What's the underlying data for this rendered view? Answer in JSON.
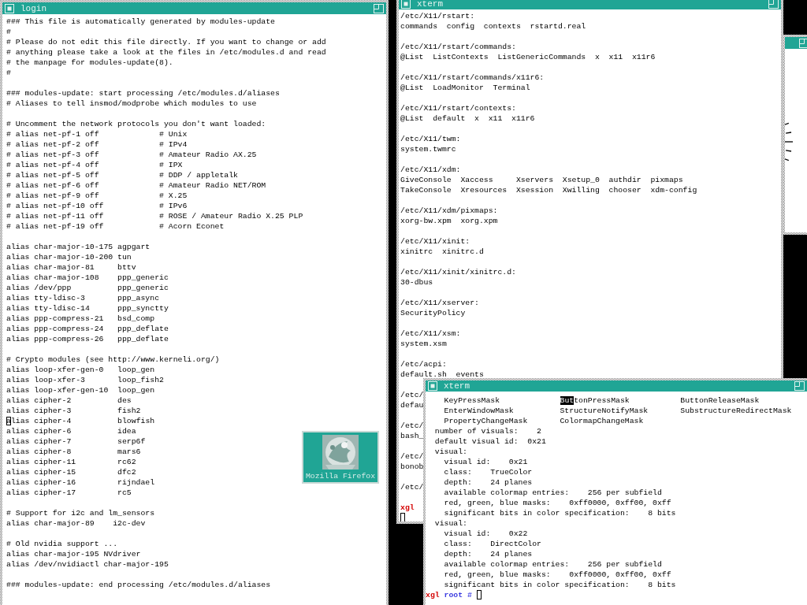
{
  "windows": [
    {
      "kind": "terminal",
      "title": "login",
      "blocks": [
        [
          "### This file is automatically generated by modules-update",
          "#",
          "# Please do not edit this file directly. If you want to change or add",
          "# anything please take a look at the files in /etc/modules.d and read",
          "# the manpage for modules-update(8).",
          "#"
        ],
        [
          "### modules-update: start processing /etc/modules.d/aliases",
          "# Aliases to tell insmod/modprobe which modules to use"
        ],
        [
          "# Uncomment the network protocols you don't want loaded:",
          "# alias net-pf-1 off             # Unix",
          "# alias net-pf-2 off             # IPv4",
          "# alias net-pf-3 off             # Amateur Radio AX.25",
          "# alias net-pf-4 off             # IPX",
          "# alias net-pf-5 off             # DDP / appletalk",
          "# alias net-pf-6 off             # Amateur Radio NET/ROM",
          "# alias net-pf-9 off             # X.25",
          "# alias net-pf-10 off            # IPv6",
          "# alias net-pf-11 off            # ROSE / Amateur Radio X.25 PLP",
          "# alias net-pf-19 off            # Acorn Econet"
        ],
        [
          "alias char-major-10-175 agpgart",
          "alias char-major-10-200 tun",
          "alias char-major-81     bttv",
          "alias char-major-108    ppp_generic",
          "alias /dev/ppp          ppp_generic",
          "alias tty-ldisc-3       ppp_async",
          "alias tty-ldisc-14      ppp_synctty",
          "alias ppp-compress-21   bsd_comp",
          "alias ppp-compress-24   ppp_deflate",
          "alias ppp-compress-26   ppp_deflate"
        ],
        [
          "# Crypto modules (see http://www.kerneli.org/)",
          "alias loop-xfer-gen-0   loop_gen",
          "alias loop-xfer-3       loop_fish2",
          "alias loop-xfer-gen-10  loop_gen",
          "alias cipher-2          des",
          "alias cipher-3          fish2",
          {
            "kind": "text",
            "text": "alias cipher-4          blowfish",
            "cursor": true
          },
          "alias cipher-6          idea",
          "alias cipher-7          serp6f",
          "alias cipher-8          mars6",
          "alias cipher-11         rc62",
          "alias cipher-15         dfc2",
          "alias cipher-16         rijndael",
          "alias cipher-17         rc5"
        ],
        [
          "# Support for i2c and lm_sensors",
          "alias char-major-89    i2c-dev"
        ],
        [
          "# Old nvidia support ...",
          "alias char-major-195 NVdriver",
          "alias /dev/nvidiactl char-major-195"
        ],
        [
          "### modules-update: end processing /etc/modules.d/aliases"
        ]
      ]
    },
    {
      "kind": "terminal",
      "title": "xterm",
      "blocks": [
        [
          "/etc/X11/rstart:",
          "commands  config  contexts  rstartd.real"
        ],
        [
          "/etc/X11/rstart/commands:",
          "@List  ListContexts  ListGenericCommands  x  x11  x11r6"
        ],
        [
          "/etc/X11/rstart/commands/x11r6:",
          "@List  LoadMonitor  Terminal"
        ],
        [
          "/etc/X11/rstart/contexts:",
          "@List  default  x  x11  x11r6"
        ],
        [
          "/etc/X11/twm:",
          "system.twmrc"
        ],
        [
          "/etc/X11/xdm:",
          "GiveConsole  Xaccess     Xservers  Xsetup_0  authdir  pixmaps",
          "TakeConsole  Xresources  Xsession  Xwilling  chooser  xdm-config"
        ],
        [
          "/etc/X11/xdm/pixmaps:",
          "xorg-bw.xpm  xorg.xpm"
        ],
        [
          "/etc/X11/xinit:",
          "xinitrc  xinitrc.d"
        ],
        [
          "/etc/X11/xinit/xinitrc.d:",
          "30-dbus"
        ],
        [
          "/etc/X11/xserver:",
          "SecurityPolicy"
        ],
        [
          "/etc/X11/xsm:",
          "system.xsm"
        ],
        [
          "/etc/acpi:",
          "default.sh  events"
        ],
        [
          "/etc/",
          "defau"
        ],
        [
          "/etc/",
          "bash_"
        ],
        [
          "/etc/",
          "bonob"
        ],
        [
          "/etc/"
        ],
        [
          {
            "kind": "prompt",
            "host": "xgl"
          },
          {
            "kind": "cursor"
          }
        ]
      ]
    },
    {
      "kind": "dial"
    },
    {
      "kind": "terminal",
      "title": "xterm",
      "blocks": [
        [
          {
            "kind": "selection",
            "parts": [
              {
                "text": "    KeyPressMask             ",
                "selected": false
              },
              {
                "text": "But",
                "selected": true
              },
              {
                "text": "tonPressMask           ButtonReleaseMask",
                "selected": false
              }
            ]
          },
          "    EnterWindowMask          StructureNotifyMask       SubstructureRedirectMask",
          "    PropertyChangeMask       ColormapChangeMask",
          "  number of visuals:    2",
          "  default visual id:  0x21",
          "  visual:",
          "    visual id:    0x21",
          "    class:    TrueColor",
          "    depth:    24 planes",
          "    available colormap entries:    256 per subfield",
          "    red, green, blue masks:    0xff0000, 0xff00, 0xff",
          "    significant bits in color specification:    8 bits",
          "  visual:",
          "    visual id:    0x22",
          "    class:    DirectColor",
          "    depth:    24 planes",
          "    available colormap entries:    256 per subfield",
          "    red, green, blue masks:    0xff0000, 0xff00, 0xff",
          "    significant bits in color specification:    8 bits",
          {
            "kind": "prompt",
            "host": "xgl",
            "user": "root",
            "symbol": "#",
            "cursor": true
          }
        ]
      ]
    }
  ],
  "desktop_icons": [
    {
      "label": "Mozilla Firefox"
    }
  ]
}
